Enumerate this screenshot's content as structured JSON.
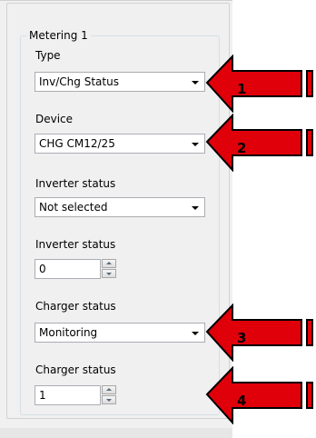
{
  "group": {
    "title": "Metering 1"
  },
  "fields": {
    "type": {
      "label": "Type",
      "value": "Inv/Chg Status"
    },
    "device": {
      "label": "Device",
      "value": "CHG CM12/25"
    },
    "inverter_status_select": {
      "label": "Inverter status",
      "value": "Not selected"
    },
    "inverter_status_number": {
      "label": "Inverter status",
      "value": "0"
    },
    "charger_status_select": {
      "label": "Charger status",
      "value": "Monitoring"
    },
    "charger_status_number": {
      "label": "Charger status",
      "value": "1"
    }
  },
  "callouts": [
    {
      "number": "1"
    },
    {
      "number": "2"
    },
    {
      "number": "3"
    },
    {
      "number": "4"
    }
  ],
  "colors": {
    "callout_fill": "#e0000a",
    "callout_stroke": "#000000",
    "panel_bg": "#f0f0f0"
  },
  "icons": {
    "dropdown": "chevron-down-icon",
    "spin_up": "spin-up-icon",
    "spin_down": "spin-down-icon",
    "callout": "arrow-left-icon"
  }
}
